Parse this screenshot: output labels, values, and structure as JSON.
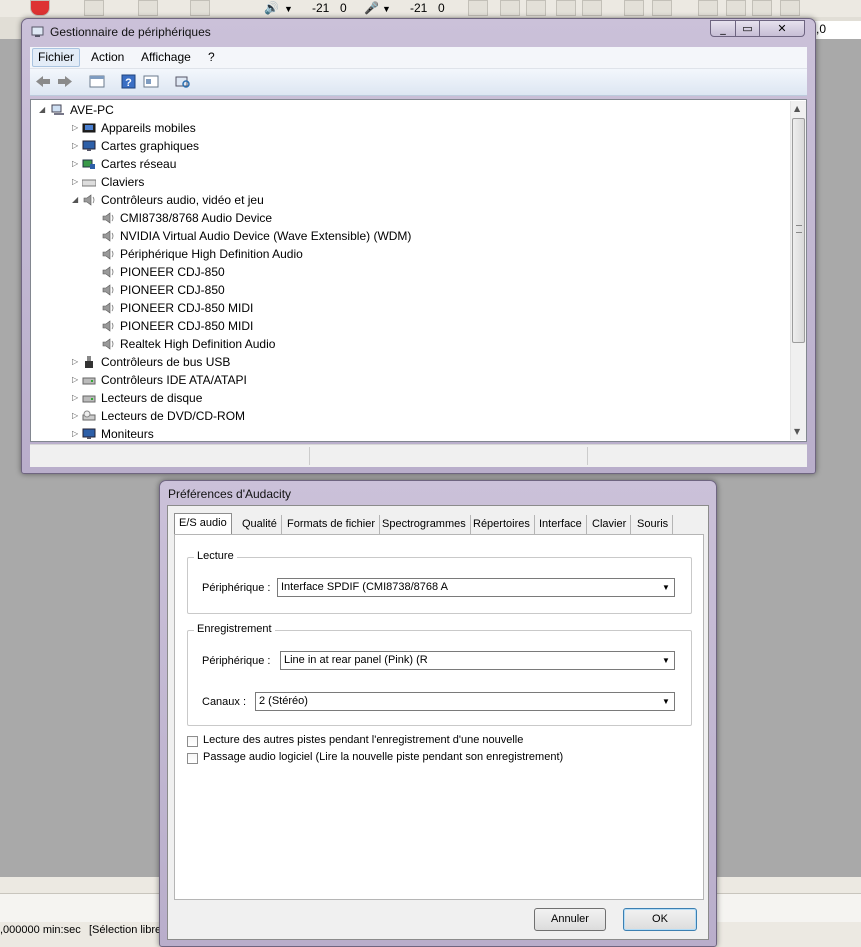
{
  "audacity": {
    "meter_play_value": "-21",
    "meter_play_zero": "0",
    "meter_rec_value": "-21",
    "meter_rec_zero": "0",
    "ruler_right": ",0",
    "status_time": ",000000 min:sec",
    "status_selection": "[Sélection libre"
  },
  "device_manager": {
    "title": "Gestionnaire de périphériques",
    "menu": [
      "Fichier",
      "Action",
      "Affichage",
      "?"
    ],
    "tree": [
      {
        "label": "AVE-PC",
        "level": 0,
        "expander": "◢",
        "icon": "computer-icon"
      },
      {
        "label": "Appareils mobiles",
        "level": 1,
        "expander": "▷",
        "icon": "mobile-device-icon"
      },
      {
        "label": "Cartes graphiques",
        "level": 1,
        "expander": "▷",
        "icon": "display-adapter-icon"
      },
      {
        "label": "Cartes réseau",
        "level": 1,
        "expander": "▷",
        "icon": "network-adapter-icon"
      },
      {
        "label": "Claviers",
        "level": 1,
        "expander": "▷",
        "icon": "keyboard-icon"
      },
      {
        "label": "Contrôleurs audio, vidéo et jeu",
        "level": 1,
        "expander": "◢",
        "icon": "speaker-icon"
      },
      {
        "label": "CMI8738/8768 Audio Device",
        "level": 2,
        "expander": "",
        "icon": "speaker-icon"
      },
      {
        "label": "NVIDIA Virtual Audio Device (Wave Extensible) (WDM)",
        "level": 2,
        "expander": "",
        "icon": "speaker-icon"
      },
      {
        "label": "Périphérique High Definition Audio",
        "level": 2,
        "expander": "",
        "icon": "speaker-icon"
      },
      {
        "label": "PIONEER CDJ-850",
        "level": 2,
        "expander": "",
        "icon": "speaker-icon"
      },
      {
        "label": "PIONEER CDJ-850",
        "level": 2,
        "expander": "",
        "icon": "speaker-icon"
      },
      {
        "label": "PIONEER CDJ-850 MIDI",
        "level": 2,
        "expander": "",
        "icon": "speaker-icon"
      },
      {
        "label": "PIONEER CDJ-850 MIDI",
        "level": 2,
        "expander": "",
        "icon": "speaker-icon"
      },
      {
        "label": "Realtek High Definition Audio",
        "level": 2,
        "expander": "",
        "icon": "speaker-icon"
      },
      {
        "label": "Contrôleurs de bus USB",
        "level": 1,
        "expander": "▷",
        "icon": "usb-icon"
      },
      {
        "label": "Contrôleurs IDE ATA/ATAPI",
        "level": 1,
        "expander": "▷",
        "icon": "ide-controller-icon"
      },
      {
        "label": "Lecteurs de disque",
        "level": 1,
        "expander": "▷",
        "icon": "disk-drive-icon"
      },
      {
        "label": "Lecteurs de DVD/CD-ROM",
        "level": 1,
        "expander": "▷",
        "icon": "dvd-drive-icon"
      },
      {
        "label": "Moniteurs",
        "level": 1,
        "expander": "▷",
        "icon": "monitor-icon"
      }
    ]
  },
  "preferences": {
    "title": "Préférences d'Audacity",
    "tabs": [
      "E/S audio",
      "Qualité",
      "Formats de fichier",
      "Spectrogrammes",
      "Répertoires",
      "Interface",
      "Clavier",
      "Souris"
    ],
    "playback": {
      "group_title": "Lecture",
      "device_label": "Périphérique :",
      "device_value": "Interface SPDIF (CMI8738/8768 A"
    },
    "recording": {
      "group_title": "Enregistrement",
      "device_label": "Périphérique :",
      "device_value": "Line in at rear panel (Pink) (R",
      "channels_label": "Canaux :",
      "channels_value": "2 (Stéréo)"
    },
    "options": [
      "Lecture des autres pistes pendant l'enregistrement d'une nouvelle",
      "Passage audio logiciel (Lire la nouvelle piste pendant son enregistrement)"
    ],
    "cancel_label": "Annuler",
    "ok_label": "OK"
  }
}
